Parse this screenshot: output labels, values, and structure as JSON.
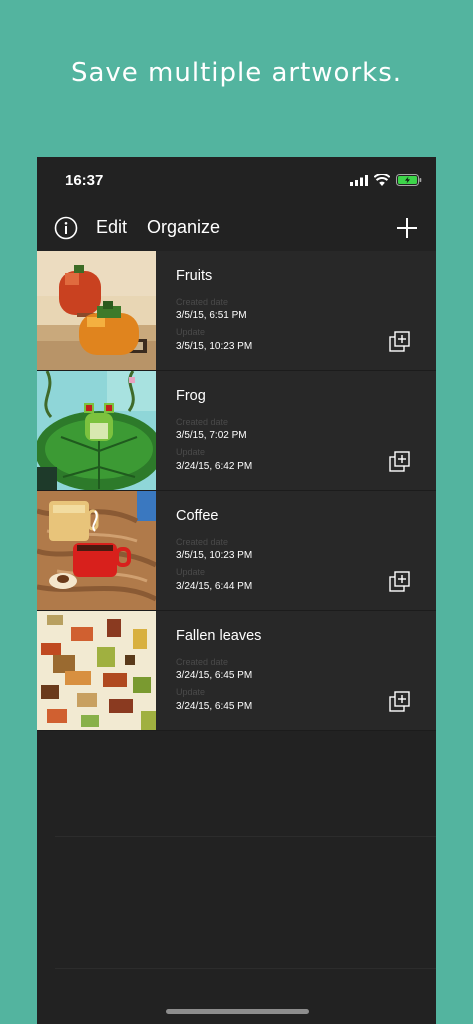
{
  "headline": "Save multiple artworks.",
  "status_bar": {
    "time": "16:37"
  },
  "nav": {
    "edit": "Edit",
    "organize": "Organize",
    "info_icon": "info-icon",
    "add_icon": "plus-icon"
  },
  "labels": {
    "created": "Created date",
    "updated": "Update"
  },
  "artworks": [
    {
      "title": "Fruits",
      "created": "3/5/15, 6:51 PM",
      "updated": "3/5/15, 10:23 PM"
    },
    {
      "title": "Frog",
      "created": "3/5/15, 7:02 PM",
      "updated": "3/24/15, 6:42 PM"
    },
    {
      "title": "Coffee",
      "created": "3/5/15, 10:23 PM",
      "updated": "3/24/15, 6:44 PM"
    },
    {
      "title": "Fallen leaves",
      "created": "3/24/15, 6:45 PM",
      "updated": "3/24/15, 6:45 PM"
    }
  ],
  "colors": {
    "background": "#53b49f",
    "screen": "#222222",
    "row": "#282828",
    "battery": "#3dd44a"
  }
}
